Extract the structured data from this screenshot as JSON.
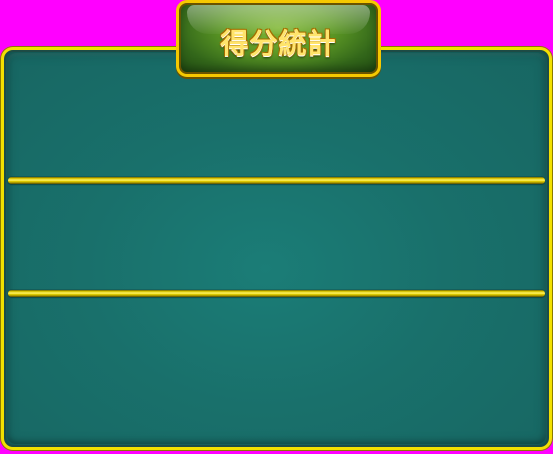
{
  "title": {
    "text": "得分統計"
  },
  "panel": {
    "sections": [
      {
        "name": "section-1"
      },
      {
        "name": "section-2"
      },
      {
        "name": "section-3"
      }
    ]
  },
  "colors": {
    "background": "#ff00ff",
    "panel_fill": "#19706b",
    "panel_border": "#f2e000",
    "title_fill": "#5d9925",
    "title_border": "#f6c800",
    "title_text": "#ffe46b"
  }
}
